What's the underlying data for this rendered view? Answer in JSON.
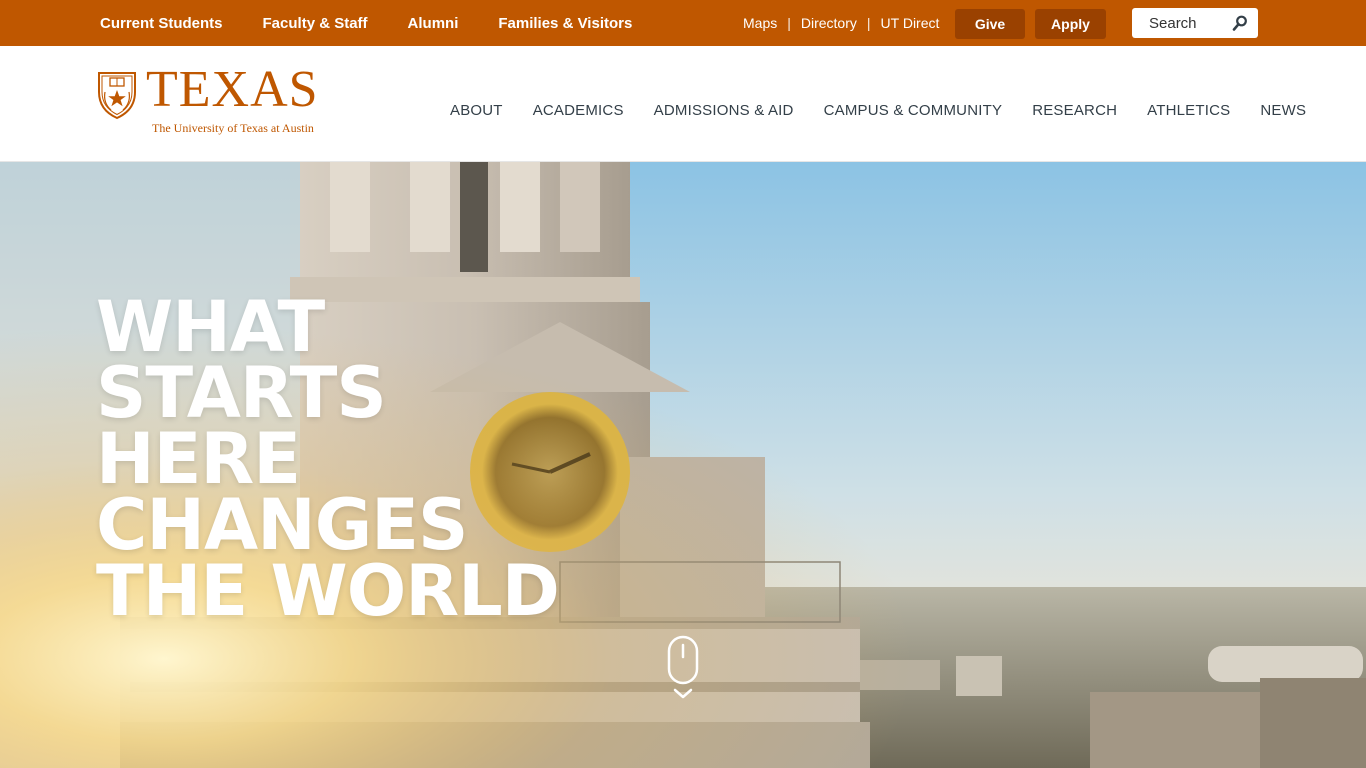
{
  "utility_bar": {
    "audience_links": [
      "Current Students",
      "Faculty & Staff",
      "Alumni",
      "Families & Visitors"
    ],
    "quick_links": [
      "Maps",
      "Directory",
      "UT Direct"
    ],
    "give_label": "Give",
    "apply_label": "Apply",
    "search_placeholder": "Search"
  },
  "header": {
    "logo_wordmark": "TEXAS",
    "logo_tagline": "The University of Texas at Austin",
    "nav": [
      "ABOUT",
      "ACADEMICS",
      "ADMISSIONS & AID",
      "CAMPUS & COMMUNITY",
      "RESEARCH",
      "ATHLETICS",
      "NEWS"
    ]
  },
  "hero": {
    "headline_lines": [
      "WHAT",
      "STARTS",
      "HERE",
      "CHANGES",
      "THE WORLD"
    ]
  },
  "colors": {
    "burnt_orange": "#bf5700",
    "dark_orange": "#9a4100",
    "nav_text": "#333f48"
  },
  "icons": {
    "search": "search-icon",
    "seal": "ut-seal-icon",
    "scroll": "mouse-scroll-icon"
  }
}
